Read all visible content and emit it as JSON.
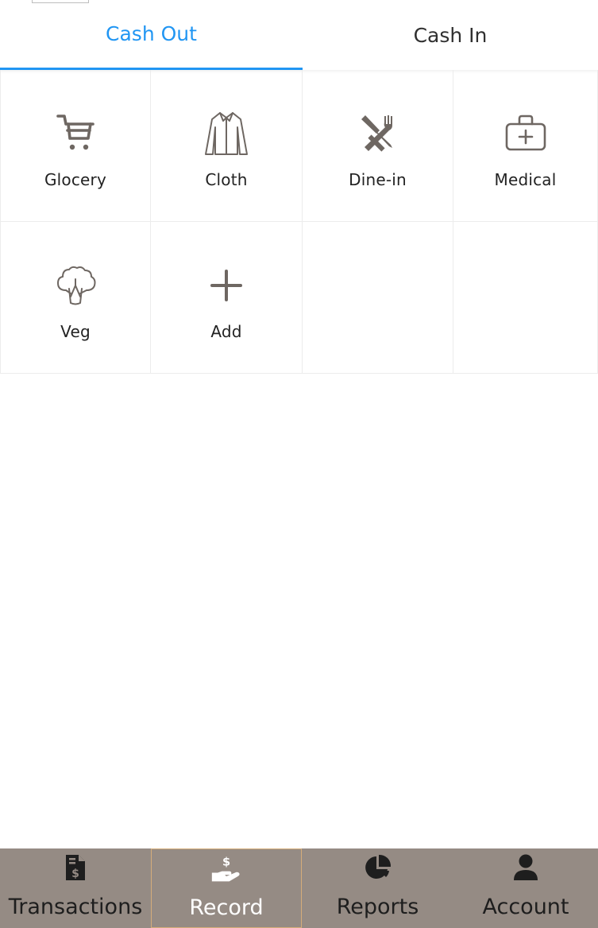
{
  "tabs": {
    "cash_out": "Cash Out",
    "cash_in": "Cash In",
    "active": "cash_out"
  },
  "categories": [
    {
      "label": "Glocery",
      "icon": "shopping-cart-icon"
    },
    {
      "label": "Cloth",
      "icon": "shirt-icon"
    },
    {
      "label": "Dine-in",
      "icon": "fork-knife-icon"
    },
    {
      "label": "Medical",
      "icon": "medical-kit-icon"
    },
    {
      "label": "Veg",
      "icon": "broccoli-icon"
    },
    {
      "label": "Add",
      "icon": "plus-icon"
    }
  ],
  "bottom_nav": [
    {
      "label": "Transactions",
      "icon": "invoice-dollar-icon"
    },
    {
      "label": "Record",
      "icon": "hand-dollar-icon"
    },
    {
      "label": "Reports",
      "icon": "pie-chart-icon"
    },
    {
      "label": "Account",
      "icon": "user-icon"
    }
  ],
  "bottom_nav_active": "Record",
  "colors": {
    "accent": "#2196f3",
    "nav_background": "#958b84",
    "icon": "#6e6762",
    "nav_active_border": "#d5ad7a"
  }
}
